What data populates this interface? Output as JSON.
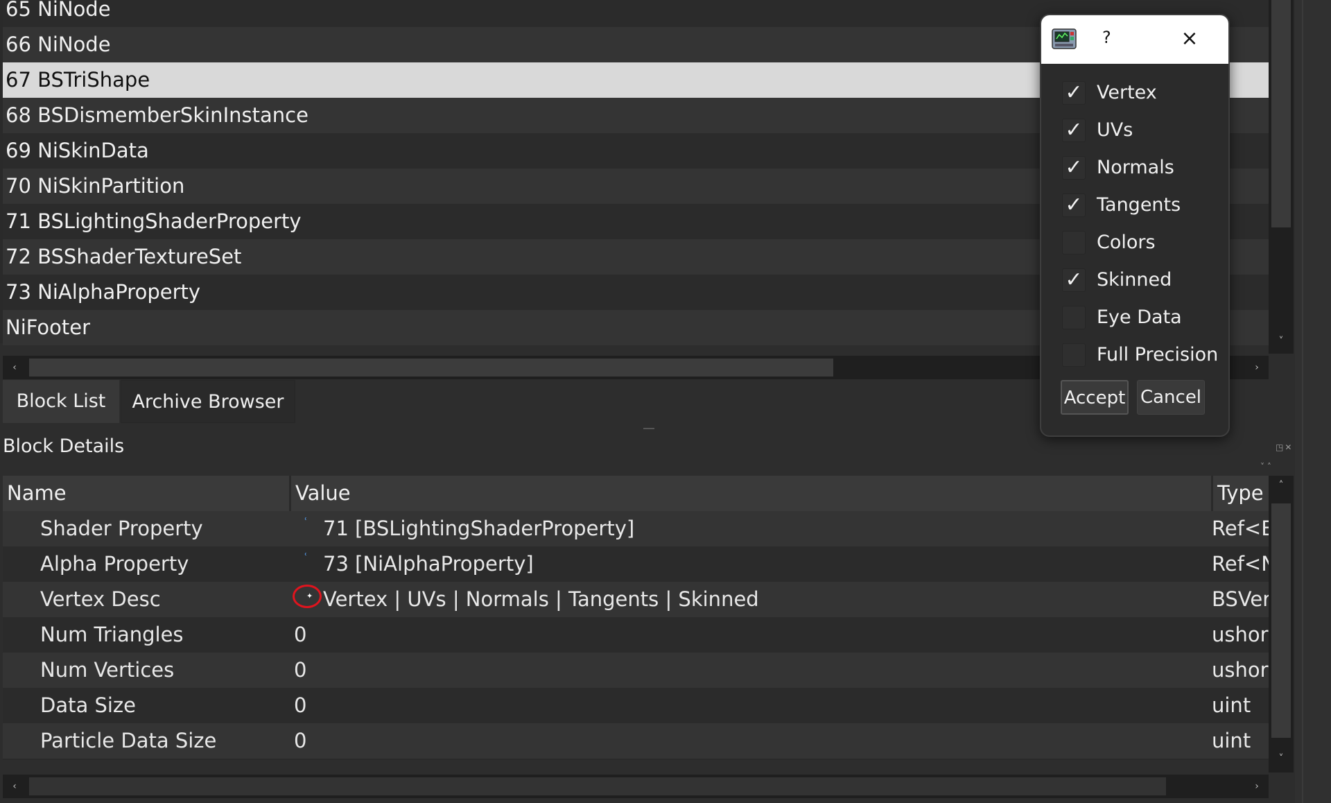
{
  "block_list": {
    "rows": [
      {
        "label": "65 NiNode",
        "selected": false
      },
      {
        "label": "66 NiNode",
        "selected": false
      },
      {
        "label": "67 BSTriShape",
        "selected": true
      },
      {
        "label": "68 BSDismemberSkinInstance",
        "selected": false
      },
      {
        "label": "69 NiSkinData",
        "selected": false
      },
      {
        "label": "70 NiSkinPartition",
        "selected": false
      },
      {
        "label": "71 BSLightingShaderProperty",
        "selected": false
      },
      {
        "label": "72 BSShaderTextureSet",
        "selected": false
      },
      {
        "label": "73 NiAlphaProperty",
        "selected": false
      },
      {
        "label": "NiFooter",
        "selected": false
      }
    ]
  },
  "tabs": {
    "block_list": "Block List",
    "archive_browser": "Archive Browser"
  },
  "details": {
    "title": "Block Details",
    "headers": {
      "name": "Name",
      "value": "Value",
      "type": "Type"
    },
    "rows": [
      {
        "name": "Shader Property",
        "value": "71 [BSLightingShaderProperty]",
        "type": "Ref<BSShaderProperty>",
        "marker": "ref"
      },
      {
        "name": "Alpha Property",
        "value": "73 [NiAlphaProperty]",
        "type": "Ref<NiAlphaProperty>",
        "marker": "ref"
      },
      {
        "name": "Vertex Desc",
        "value": "Vertex | UVs | Normals | Tangents | Skinned",
        "type": "BSVertexDesc",
        "marker": "edit"
      },
      {
        "name": "Num Triangles",
        "value": "0",
        "type": "ushort",
        "marker": ""
      },
      {
        "name": "Num Vertices",
        "value": "0",
        "type": "ushort",
        "marker": ""
      },
      {
        "name": "Data Size",
        "value": "0",
        "type": "uint",
        "marker": ""
      },
      {
        "name": "Particle Data Size",
        "value": "0",
        "type": "uint",
        "marker": ""
      }
    ]
  },
  "dialog": {
    "title": "?",
    "close_icon": "×",
    "options": [
      {
        "label": "Vertex",
        "checked": true
      },
      {
        "label": "UVs",
        "checked": true
      },
      {
        "label": "Normals",
        "checked": true
      },
      {
        "label": "Tangents",
        "checked": true
      },
      {
        "label": "Colors",
        "checked": false
      },
      {
        "label": "Skinned",
        "checked": true
      },
      {
        "label": "Eye Data",
        "checked": false
      },
      {
        "label": "Full Precision",
        "checked": false
      }
    ],
    "accept_label": "Accept",
    "cancel_label": "Cancel"
  },
  "icons": {
    "check": "✓",
    "arrow_left": "‹",
    "arrow_right": "›",
    "arrow_up": "˄",
    "arrow_down": "˅",
    "dock_buttons": "◳✕"
  },
  "colors": {
    "selected_row": "#d9d9d9",
    "highlight_circle": "#e0141e",
    "ref_marker": "#58a6ff"
  }
}
